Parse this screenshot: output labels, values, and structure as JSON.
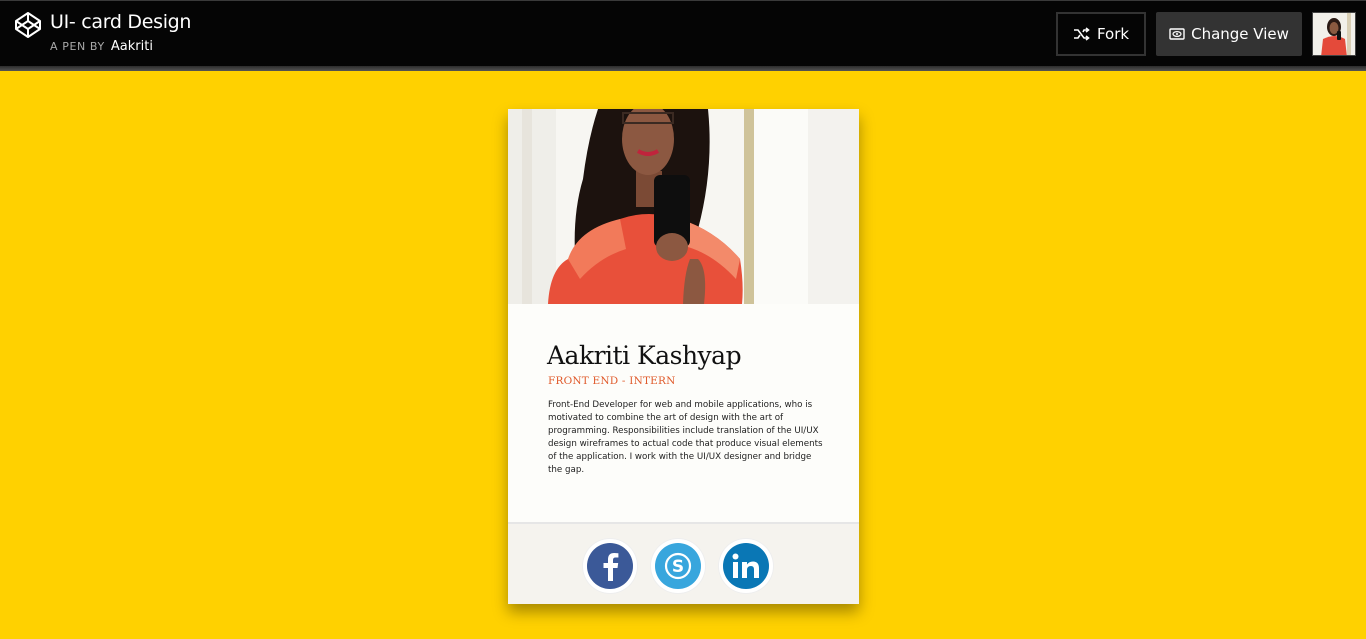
{
  "header": {
    "title": "UI- card Design",
    "byline_prefix": "A PEN BY",
    "author": "Aakriti",
    "fork_label": "Fork",
    "change_view_label": "Change View"
  },
  "card": {
    "name": "Aakriti Kashyap",
    "role": "FRONT END - INTERN",
    "bio": "Front-End Developer for web and mobile applications, who is motivated to combine the art of design with the art of programming. Responsibilities include translation of the UI/UX design wireframes to actual code that produce visual elements of the application. I work with the UI/UX designer and bridge the gap.",
    "social": [
      {
        "name": "facebook",
        "icon": "facebook-icon",
        "color": "#3b5998"
      },
      {
        "name": "skype",
        "icon": "skype-icon",
        "color": "#38a6dd"
      },
      {
        "name": "linkedin",
        "icon": "linkedin-icon",
        "color": "#0a77b5"
      }
    ]
  },
  "colors": {
    "background": "#ffd100",
    "topbar": "#050505",
    "role_accent": "#e05a2b"
  }
}
